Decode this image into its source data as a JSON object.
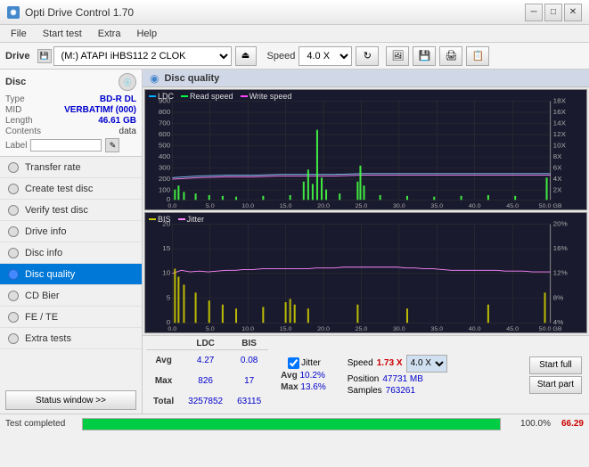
{
  "app": {
    "title": "Opti Drive Control 1.70",
    "icon": "◉"
  },
  "titlebar": {
    "minimize": "─",
    "maximize": "□",
    "close": "✕"
  },
  "menu": {
    "items": [
      "File",
      "Start test",
      "Extra",
      "Help"
    ]
  },
  "toolbar": {
    "drive_label": "Drive",
    "drive_value": "(M:)  ATAPI iHBS112  2 CLOK",
    "speed_label": "Speed",
    "speed_value": "4.0 X"
  },
  "disc": {
    "title": "Disc",
    "type_label": "Type",
    "type_value": "BD-R DL",
    "mid_label": "MID",
    "mid_value": "VERBATIMf (000)",
    "length_label": "Length",
    "length_value": "46.61 GB",
    "contents_label": "Contents",
    "contents_value": "data",
    "label_label": "Label"
  },
  "nav": {
    "items": [
      {
        "id": "transfer-rate",
        "label": "Transfer rate",
        "active": false
      },
      {
        "id": "create-test-disc",
        "label": "Create test disc",
        "active": false
      },
      {
        "id": "verify-test-disc",
        "label": "Verify test disc",
        "active": false
      },
      {
        "id": "drive-info",
        "label": "Drive info",
        "active": false
      },
      {
        "id": "disc-info",
        "label": "Disc info",
        "active": false
      },
      {
        "id": "disc-quality",
        "label": "Disc quality",
        "active": true
      },
      {
        "id": "cd-bier",
        "label": "CD Bier",
        "active": false
      },
      {
        "id": "fe-te",
        "label": "FE / TE",
        "active": false
      },
      {
        "id": "extra-tests",
        "label": "Extra tests",
        "active": false
      }
    ],
    "status_button": "Status window >>"
  },
  "chart": {
    "title": "Disc quality",
    "top": {
      "legend": [
        "LDC",
        "Read speed",
        "Write speed"
      ],
      "y_left": [
        "900",
        "800",
        "700",
        "600",
        "500",
        "400",
        "300",
        "200",
        "100",
        "0"
      ],
      "y_right": [
        "18X",
        "16X",
        "14X",
        "12X",
        "10X",
        "8X",
        "6X",
        "4X",
        "2X"
      ],
      "x_labels": [
        "0.0",
        "5.0",
        "10.0",
        "15.0",
        "20.0",
        "25.0",
        "30.0",
        "35.0",
        "40.0",
        "45.0",
        "50.0 GB"
      ]
    },
    "bottom": {
      "legend": [
        "BIS",
        "Jitter"
      ],
      "y_left": [
        "20",
        "15",
        "10",
        "5",
        "0"
      ],
      "y_right": [
        "20%",
        "16%",
        "12%",
        "8%",
        "4%"
      ],
      "x_labels": [
        "0.0",
        "5.0",
        "10.0",
        "15.0",
        "20.0",
        "25.0",
        "30.0",
        "35.0",
        "40.0",
        "45.0",
        "50.0 GB"
      ]
    }
  },
  "stats": {
    "headers": [
      "LDC",
      "BIS",
      "",
      "Jitter",
      "Speed",
      ""
    ],
    "avg_label": "Avg",
    "avg_ldc": "4.27",
    "avg_bis": "0.08",
    "avg_jitter": "10.2%",
    "max_label": "Max",
    "max_ldc": "826",
    "max_bis": "17",
    "max_jitter": "13.6%",
    "total_label": "Total",
    "total_ldc": "3257852",
    "total_bis": "63115",
    "speed_label": "Speed",
    "speed_value": "1.73 X",
    "position_label": "Position",
    "position_value": "47731 MB",
    "samples_label": "Samples",
    "samples_value": "763261",
    "jitter_checked": true,
    "speed_select": "4.0 X",
    "start_full_label": "Start full",
    "start_part_label": "Start part"
  },
  "progress": {
    "status": "Test completed",
    "percent": "100.0%",
    "fill_width": "100",
    "score": "66.29"
  }
}
